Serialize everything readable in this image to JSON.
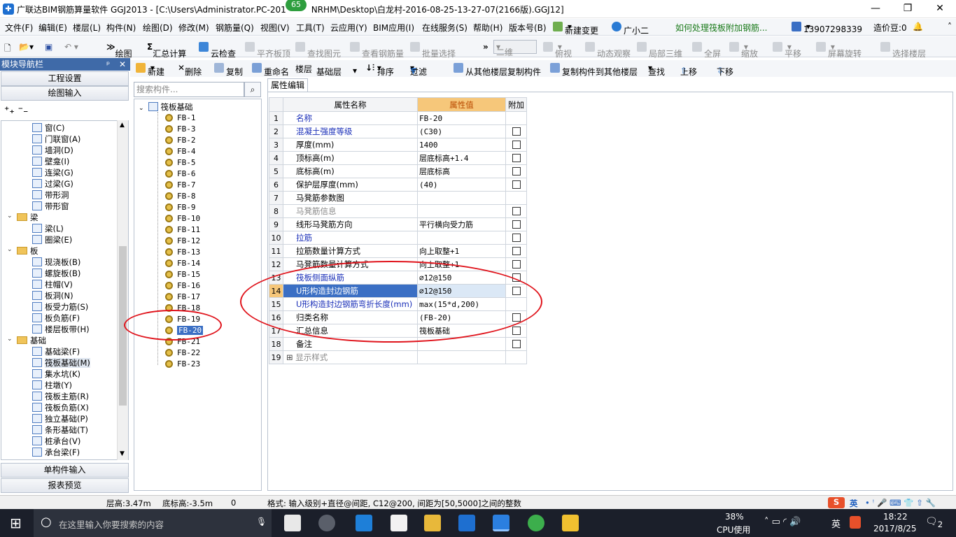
{
  "window": {
    "title": "广联达BIM钢筋算量软件 GGJ2013 - [C:\\Users\\Administrator.PC-201",
    "title_tail": "NRHM\\Desktop\\白龙村-2016-08-25-13-27-07(2166版).GGJ12]",
    "badge": "65"
  },
  "menu": {
    "items": [
      "文件(F)",
      "编辑(E)",
      "楼层(L)",
      "构件(N)",
      "绘图(D)",
      "修改(M)",
      "钢筋量(Q)",
      "视图(V)",
      "工具(T)",
      "云应用(Y)",
      "BIM应用(I)",
      "在线服务(S)",
      "帮助(H)",
      "版本号(B)"
    ],
    "new_change": "新建变更",
    "assistant": "广小二",
    "help_link": "如何处理筏板附加钢筋...",
    "phone": "13907298339",
    "beans": "造价豆:0"
  },
  "toolbar": {
    "draw": "绘图",
    "sum_calc": "汇总计算",
    "cloud_check": "云检查",
    "flat_top": "平齐板顶",
    "find_elem": "查找图元",
    "view_rebar": "查看钢筋量",
    "batch_select": "批量选择",
    "view_mode": "二维",
    "top_view": "俯视",
    "dynamic_view": "动态观察",
    "local_3d": "局部三维",
    "fullscreen": "全屏",
    "zoom": "缩放",
    "pan": "平移",
    "rotate": "屏幕旋转",
    "select_floor": "选择楼层"
  },
  "nav": {
    "header": "模块导航栏",
    "project_settings": "工程设置",
    "draw_input": "绘图输入",
    "single_input": "单构件输入",
    "report_preview": "报表预览",
    "items": [
      {
        "label": "窗(C)",
        "level": 2
      },
      {
        "label": "门联窗(A)",
        "level": 2
      },
      {
        "label": "墙洞(D)",
        "level": 2
      },
      {
        "label": "壁龛(I)",
        "level": 2
      },
      {
        "label": "连梁(G)",
        "level": 2
      },
      {
        "label": "过梁(G)",
        "level": 2
      },
      {
        "label": "带形洞",
        "level": 2
      },
      {
        "label": "带形窗",
        "level": 2
      },
      {
        "label": "梁",
        "level": 1
      },
      {
        "label": "梁(L)",
        "level": 2
      },
      {
        "label": "圈梁(E)",
        "level": 2
      },
      {
        "label": "板",
        "level": 1
      },
      {
        "label": "现浇板(B)",
        "level": 2
      },
      {
        "label": "螺旋板(B)",
        "level": 2
      },
      {
        "label": "柱帽(V)",
        "level": 2
      },
      {
        "label": "板洞(N)",
        "level": 2
      },
      {
        "label": "板受力筋(S)",
        "level": 2
      },
      {
        "label": "板负筋(F)",
        "level": 2
      },
      {
        "label": "楼层板带(H)",
        "level": 2
      },
      {
        "label": "基础",
        "level": 1
      },
      {
        "label": "基础梁(F)",
        "level": 2
      },
      {
        "label": "筏板基础(M)",
        "level": 2
      },
      {
        "label": "集水坑(K)",
        "level": 2
      },
      {
        "label": "柱墩(Y)",
        "level": 2
      },
      {
        "label": "筏板主筋(R)",
        "level": 2
      },
      {
        "label": "筏板负筋(X)",
        "level": 2
      },
      {
        "label": "独立基础(P)",
        "level": 2
      },
      {
        "label": "条形基础(T)",
        "level": 2
      },
      {
        "label": "桩承台(V)",
        "level": 2
      },
      {
        "label": "承台梁(F)",
        "level": 2
      }
    ]
  },
  "comp_toolbar": {
    "new": "新建",
    "delete": "删除",
    "copy": "复制",
    "rename": "重命名",
    "floor_label": "楼层",
    "floor_value": "基础层",
    "sort": "排序",
    "filter": "过滤",
    "copy_from": "从其他楼层复制构件",
    "copy_to": "复制构件到其他楼层",
    "find": "查找",
    "move_up": "上移",
    "move_down": "下移"
  },
  "search": {
    "placeholder": "搜索构件..."
  },
  "tree": {
    "root": "筏板基础",
    "items": [
      "FB-1",
      "FB-3",
      "FB-2",
      "FB-4",
      "FB-5",
      "FB-6",
      "FB-7",
      "FB-8",
      "FB-9",
      "FB-10",
      "FB-11",
      "FB-12",
      "FB-13",
      "FB-14",
      "FB-15",
      "FB-16",
      "FB-17",
      "FB-18",
      "FB-19",
      "FB-20",
      "FB-21",
      "FB-22",
      "FB-23"
    ],
    "selected": "FB-20"
  },
  "props": {
    "tab": "属性编辑",
    "col_name": "属性名称",
    "col_value": "属性值",
    "col_extra": "附加",
    "rows": [
      {
        "n": "1",
        "name": "名称",
        "value": "FB-20",
        "style": "blue",
        "chk": false
      },
      {
        "n": "2",
        "name": "混凝土强度等级",
        "value": "(C30)",
        "style": "blue",
        "chk": true
      },
      {
        "n": "3",
        "name": "厚度(mm)",
        "value": "1400",
        "style": "",
        "chk": true
      },
      {
        "n": "4",
        "name": "顶标高(m)",
        "value": "层底标高+1.4",
        "style": "",
        "chk": true
      },
      {
        "n": "5",
        "name": "底标高(m)",
        "value": "层底标高",
        "style": "",
        "chk": true
      },
      {
        "n": "6",
        "name": "保护层厚度(mm)",
        "value": "(40)",
        "style": "",
        "chk": true
      },
      {
        "n": "7",
        "name": "马凳筋参数图",
        "value": "",
        "style": "",
        "chk": false
      },
      {
        "n": "8",
        "name": "马凳筋信息",
        "value": "",
        "style": "gray",
        "chk": true
      },
      {
        "n": "9",
        "name": "线形马凳筋方向",
        "value": "平行横向受力筋",
        "style": "",
        "chk": true
      },
      {
        "n": "10",
        "name": "拉筋",
        "value": "",
        "style": "blue",
        "chk": true
      },
      {
        "n": "11",
        "name": "拉筋数量计算方式",
        "value": "向上取整+1",
        "style": "",
        "chk": true
      },
      {
        "n": "12",
        "name": "马凳筋数量计算方式",
        "value": "向上取整+1",
        "style": "",
        "chk": true
      },
      {
        "n": "13",
        "name": "筏板侧面纵筋",
        "value": "⌀12@150",
        "style": "blue",
        "chk": true
      },
      {
        "n": "14",
        "name": "U形构造封边钢筋",
        "value": "⌀12@150",
        "style": "blue",
        "chk": true,
        "selected": true
      },
      {
        "n": "15",
        "name": "U形构造封边钢筋弯折长度(mm)",
        "value": "max(15*d,200)",
        "style": "blue",
        "chk": false
      },
      {
        "n": "16",
        "name": "归类名称",
        "value": "(FB-20)",
        "style": "",
        "chk": true
      },
      {
        "n": "17",
        "name": "汇总信息",
        "value": "筏板基础",
        "style": "",
        "chk": true
      },
      {
        "n": "18",
        "name": "备注",
        "value": "",
        "style": "",
        "chk": true
      },
      {
        "n": "19",
        "name": "显示样式",
        "value": "",
        "style": "gray",
        "chk": false,
        "expand": true
      }
    ]
  },
  "status": {
    "floor_height": "层高:3.47m",
    "bottom_elev": "底标高:-3.5m",
    "count": "0",
    "hint": "格式: 输入级别+直径@间距, C12@200, 间距为[50,5000]之间的整数",
    "ime": "英"
  },
  "taskbar": {
    "search_placeholder": "在这里输入你要搜索的内容",
    "cpu_pct": "38%",
    "cpu_label": "CPU使用",
    "ime": "英",
    "time": "18:22",
    "date": "2017/8/25",
    "notif": "2"
  }
}
